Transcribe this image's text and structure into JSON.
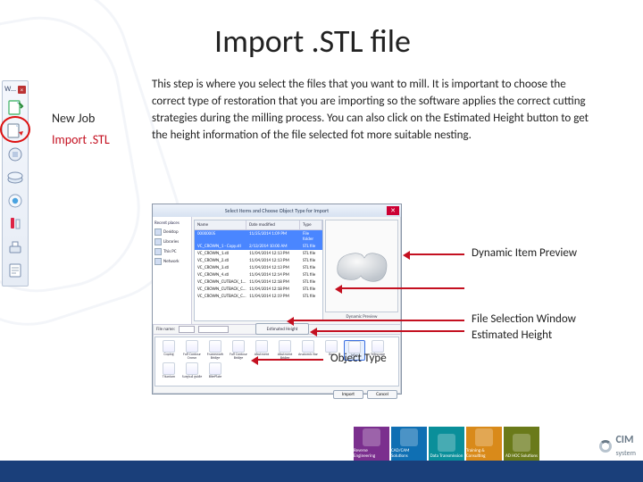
{
  "title": "Import .STL file",
  "description": "This step is where you select the files that you want to mill. It is important to choose the correct type of restoration that you are importing so the software applies the correct cutting strategies during the milling process. You can also click on the Estimated Height button to get the height information of the file selected fot more suitable nesting.",
  "steps": {
    "new_job": "New Job",
    "import_stl": "Import .STL"
  },
  "toolbar": {
    "tab_label": "W…"
  },
  "dialog": {
    "title": "Select Items and Choose Object Type for Import",
    "nav_head": "Recent places",
    "nav_items": [
      "Desktop",
      "Libraries",
      "This PC",
      "Network"
    ],
    "columns": {
      "name": "Name",
      "date": "Date modified",
      "type": "Type"
    },
    "rows": [
      {
        "name": "00000005",
        "date": "11/25/2014 1:09 PM",
        "type": "File folder",
        "sel": true
      },
      {
        "name": "VC_CROWN_1 - Copy.stl",
        "date": "2/13/2014 10:00 AM",
        "type": "STL file",
        "sel": true
      },
      {
        "name": "VC_CROWN_1.stl",
        "date": "11/04/2014 12:13 PM",
        "type": "STL file"
      },
      {
        "name": "VC_CROWN_2.stl",
        "date": "11/04/2014 12:13 PM",
        "type": "STL file"
      },
      {
        "name": "VC_CROWN_3.stl",
        "date": "11/04/2014 12:13 PM",
        "type": "STL file"
      },
      {
        "name": "VC_CROWN_4.stl",
        "date": "11/04/2014 12:14 PM",
        "type": "STL file"
      },
      {
        "name": "VC_CROWN_CUTBACK_1…",
        "date": "11/04/2014 12:18 PM",
        "type": "STL file"
      },
      {
        "name": "VC_CROWN_CUTBACK_C…",
        "date": "11/04/2014 12:18 PM",
        "type": "STL file"
      },
      {
        "name": "VC_CROWN_CUTBACK_C…",
        "date": "11/04/2014 12:19 PM",
        "type": "STL file"
      }
    ],
    "filename_label": "File name:",
    "preview_caption": "Dynamic Preview",
    "object_types": [
      {
        "label": "Coping"
      },
      {
        "label": "Full Contour Crown"
      },
      {
        "label": "Framework Bridge"
      },
      {
        "label": "Full Contour Bridge"
      },
      {
        "label": "Abutment"
      },
      {
        "label": "Abutment Bridge"
      },
      {
        "label": "Anatomic Bar"
      },
      {
        "label": "Bar"
      },
      {
        "label": "Inlay",
        "sel": true
      },
      {
        "label": "Telescope"
      },
      {
        "label": "Titanium"
      },
      {
        "label": "Surgical guide"
      },
      {
        "label": "BitePlate"
      }
    ],
    "estimated_height_btn": "Estimated Height",
    "actions": {
      "import": "Import",
      "cancel": "Cancel"
    }
  },
  "callouts": {
    "dynamic_preview": "Dynamic Item Preview",
    "file_selection": "File Selection Window",
    "estimated_height": "Estimated Height",
    "object_type": "Object Type"
  },
  "footer": {
    "tiles": [
      "Reverse Engineering",
      "CAD/CAM Solutions",
      "Data Transmission",
      "Training & Consulting",
      "AD HOC Solutions"
    ],
    "brand": "CIM",
    "brand_sub": "system"
  }
}
